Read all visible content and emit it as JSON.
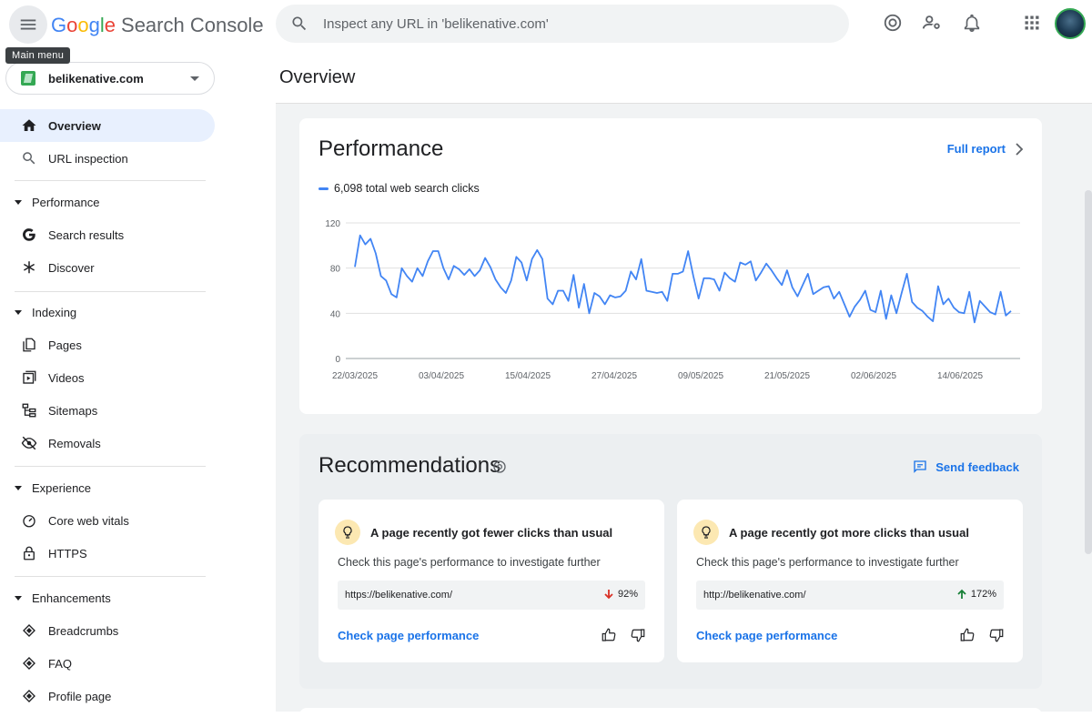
{
  "header": {
    "main_menu_tooltip": "Main menu",
    "logo_google": [
      "G",
      "o",
      "o",
      "g",
      "l",
      "e"
    ],
    "product_name": "Search Console",
    "search_placeholder": "Inspect any URL in 'belikenative.com'"
  },
  "sidebar": {
    "property": "belikenative.com",
    "items": [
      {
        "label": "Overview",
        "icon": "home-icon",
        "active": true
      },
      {
        "label": "URL inspection",
        "icon": "search-icon"
      }
    ],
    "sections": [
      {
        "label": "Performance",
        "items": [
          {
            "label": "Search results",
            "icon": "google-g-icon"
          },
          {
            "label": "Discover",
            "icon": "asterisk-icon"
          }
        ]
      },
      {
        "label": "Indexing",
        "items": [
          {
            "label": "Pages",
            "icon": "pages-icon"
          },
          {
            "label": "Videos",
            "icon": "video-icon"
          },
          {
            "label": "Sitemaps",
            "icon": "sitemap-icon"
          },
          {
            "label": "Removals",
            "icon": "eye-off-icon"
          }
        ]
      },
      {
        "label": "Experience",
        "items": [
          {
            "label": "Core web vitals",
            "icon": "gauge-icon"
          },
          {
            "label": "HTTPS",
            "icon": "lock-icon"
          }
        ]
      },
      {
        "label": "Enhancements",
        "items": [
          {
            "label": "Breadcrumbs",
            "icon": "diamond-icon"
          },
          {
            "label": "FAQ",
            "icon": "diamond-icon"
          },
          {
            "label": "Profile page",
            "icon": "diamond-icon"
          }
        ]
      }
    ]
  },
  "main": {
    "page_title": "Overview",
    "performance": {
      "title": "Performance",
      "full_report": "Full report",
      "legend": "6,098 total web search clicks"
    },
    "recommendations": {
      "title": "Recommendations",
      "send_feedback": "Send feedback",
      "cards": [
        {
          "headline": "A page recently got fewer clicks than usual",
          "desc": "Check this page's performance to investigate further",
          "url": "https://belikenative.com/",
          "pct": "92%",
          "trend": "down",
          "cta": "Check page performance"
        },
        {
          "headline": "A page recently got more clicks than usual",
          "desc": "Check this page's performance to investigate further",
          "url": "http://belikenative.com/",
          "pct": "172%",
          "trend": "up",
          "cta": "Check page performance"
        }
      ]
    }
  },
  "colors": {
    "accent": "#1a73e8",
    "series": "#4285f4",
    "trend_down": "#d93025",
    "trend_up": "#188038"
  },
  "chart_data": {
    "type": "line",
    "series": [
      {
        "name": "",
        "values": [
          81,
          109,
          101,
          106,
          93,
          73,
          69,
          57,
          54,
          80,
          73,
          68,
          80,
          73,
          86,
          95,
          95,
          80,
          70,
          82,
          79,
          74,
          79,
          73,
          78,
          89,
          81,
          70,
          63,
          58,
          69,
          90,
          85,
          69,
          88,
          96,
          88,
          53,
          48,
          60,
          60,
          51,
          74,
          45,
          66,
          40,
          58,
          55,
          48,
          56,
          54,
          55,
          60,
          77,
          70,
          88,
          60,
          59,
          58,
          59,
          51,
          75,
          75,
          77,
          95,
          73,
          53,
          71,
          71,
          70,
          60,
          76,
          71,
          68,
          85,
          83,
          86,
          69,
          76,
          84,
          78,
          71,
          65,
          78,
          63,
          55,
          65,
          75,
          57,
          60,
          63,
          64,
          53,
          59,
          48,
          37,
          46,
          52,
          60,
          43,
          41,
          60,
          35,
          56,
          40,
          58,
          75,
          50,
          45,
          42,
          37,
          33,
          64,
          48,
          53,
          45,
          41,
          40,
          59,
          32,
          51,
          46,
          41,
          39,
          59,
          38,
          42
        ]
      }
    ],
    "x_ticks": [
      "22/03/2025",
      "03/04/2025",
      "15/04/2025",
      "27/04/2025",
      "09/05/2025",
      "21/05/2025",
      "02/06/2025",
      "14/06/2025"
    ],
    "y_ticks": [
      0,
      40,
      80,
      120
    ],
    "ylim": [
      0,
      120
    ],
    "grid": true
  }
}
